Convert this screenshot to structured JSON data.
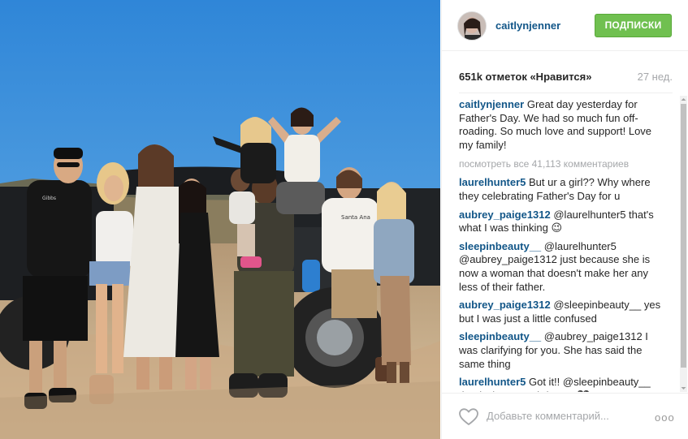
{
  "post": {
    "username": "caitlynjenner",
    "follow_label": "ПОДПИСКИ",
    "likes": "651k отметок «Нравится»",
    "time_ago": "27 нед.",
    "view_all": "посмотреть все 41,113 комментариев",
    "caption": {
      "user": "caitlynjenner",
      "text": "Great day yesterday for Father's Day. We had so much fun off-roading. So much love and support! Love my family!"
    },
    "comments": [
      {
        "user": "laurelhunter5",
        "text": "But ur a girl?? Why where they celebrating Father's Day for u"
      },
      {
        "user": "aubrey_paige1312",
        "text": "@laurelhunter5 that's what I was thinking 😉"
      },
      {
        "user": "sleepinbeauty__",
        "text": "@laurelhunter5 @aubrey_paige1312 just because she is now a woman that doesn't make her any less of their father."
      },
      {
        "user": "aubrey_paige1312",
        "text": "@sleepinbeauty__ yes but I was just a little confused"
      },
      {
        "user": "sleepinbeauty__",
        "text": "@aubrey_paige1312 I was clarifying for you. She has said the same thing"
      },
      {
        "user": "laurelhunter5",
        "text": "Got it!! @sleepinbeauty__ thanks:) merry Christmas🖤"
      }
    ],
    "add_comment_placeholder": "Добавьте комментарий...",
    "more_label": "ooo"
  },
  "photo": {
    "shirt_print_1": "Gibbs",
    "shirt_print_2": "Santa Ana"
  },
  "icons": {
    "heart": "heart-outline-icon",
    "more": "more-options-icon",
    "avatar": "avatar"
  }
}
